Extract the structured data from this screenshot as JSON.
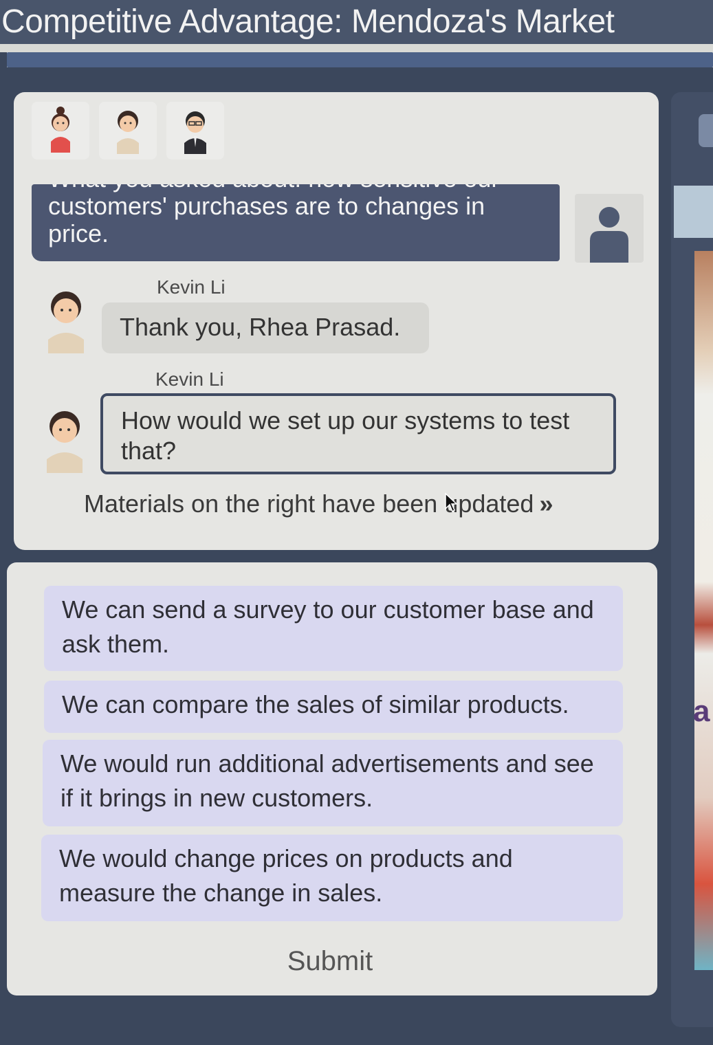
{
  "header": {
    "title": "Competitive Advantage: Mendoza's Market",
    "progress": 1.0
  },
  "chat": {
    "participants": [
      "woman-avatar",
      "kevin-li-avatar",
      "glasses-man-avatar"
    ],
    "user_message": {
      "cut_line": "What you asked about: how sensitive our",
      "text": "customers' purchases are to changes in price."
    },
    "messages": [
      {
        "speaker": "Kevin Li",
        "text": "Thank you, Rhea Prasad."
      },
      {
        "speaker": "Kevin Li",
        "text": "How would we set up our systems to test that?"
      }
    ],
    "materials_notice": "Materials on the right have been updated",
    "materials_chevron": "»"
  },
  "options": [
    "We can send a survey to our customer base and ask them.",
    "We can compare the sales of similar products.",
    "We would run additional advertisements and see if it brings in new customers.",
    "We would change prices on products and measure the change in sales."
  ],
  "submit_label": "Submit",
  "side_panel": {
    "visible_letter": "a"
  },
  "colors": {
    "header_bg": "#49556b",
    "user_bubble": "#4c5671",
    "option_bg": "#d9d8f0",
    "card_bg": "#e6e6e3"
  }
}
